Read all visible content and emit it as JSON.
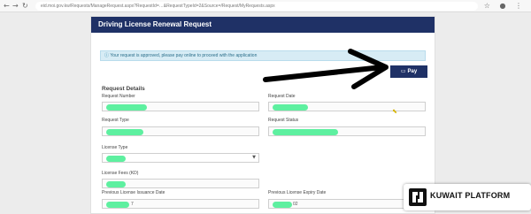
{
  "browser": {
    "url": "eid.moi.gov.kw/Requests/ManageRequest.aspx?RequestId=…&RequestTypeId=2&Source=/Request/MyRequests.aspx",
    "back_icon": "back-arrow-icon",
    "forward_icon": "forward-arrow-icon",
    "reload_icon": "reload-icon"
  },
  "panel": {
    "title": "Driving License Renewal Request"
  },
  "alert": {
    "icon": "info-icon",
    "message": "Your request is approved, please pay online to proceed with the application"
  },
  "pay_button": {
    "label": "Pay",
    "icon": "card-icon"
  },
  "details": {
    "section_title": "Request Details",
    "request_number_label": "Request Number",
    "request_date_label": "Request Date",
    "request_type_label": "Request Type",
    "request_status_label": "Request Status",
    "license_type_label": "License Type",
    "license_fees_label": "License Fees (KD)",
    "prev_issuance_label": "Previous License Issuance Date",
    "prev_expiry_label": "Previous License Expiry Date",
    "prev_issuance_value_tail": "7",
    "prev_expiry_value_tail": "02"
  },
  "watermark": {
    "text": "KUWAIT PLATFORM"
  },
  "colors": {
    "header": "#1f3166",
    "redaction": "#5ef0a0",
    "alert_bg": "#d7ecf5"
  }
}
